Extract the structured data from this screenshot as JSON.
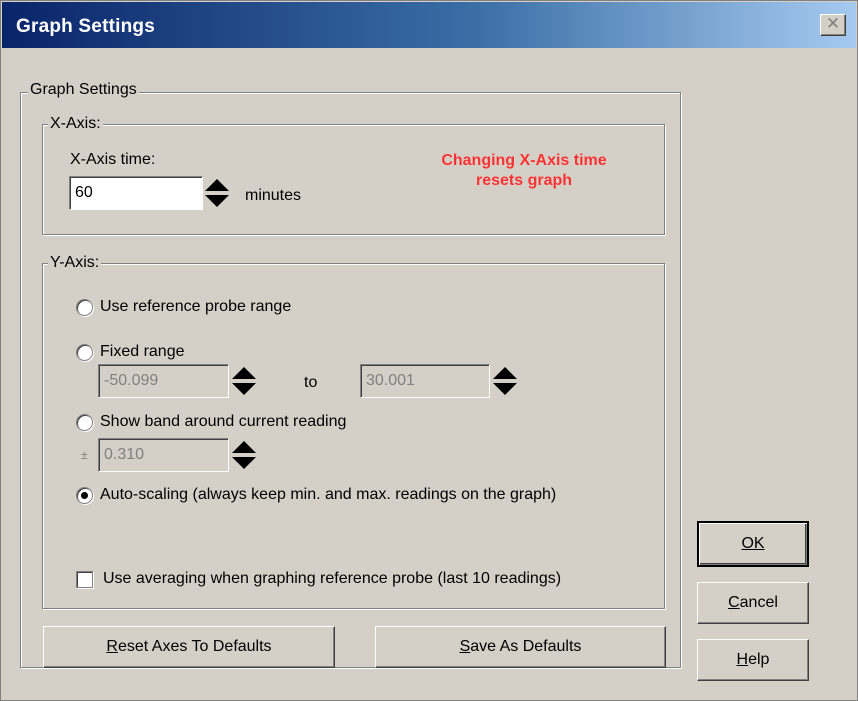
{
  "window": {
    "title": "Graph Settings",
    "close_glyph": "✕"
  },
  "group": {
    "label": "Graph Settings",
    "x_axis": {
      "label": "X-Axis:",
      "time_label": "X-Axis time:",
      "time_value": "60",
      "unit": "minutes",
      "warning_line1": "Changing X-Axis time",
      "warning_line2": "resets graph",
      "warning_color": "#ff3333"
    },
    "y_axis": {
      "label": "Y-Axis:",
      "option_reference": "Use reference probe range",
      "option_fixed": "Fixed range",
      "fixed_min": "-50.099",
      "to_label": "to",
      "fixed_max": "30.001",
      "option_band": "Show band around current reading",
      "band_symbol": "±",
      "band_value": "0.310",
      "option_auto": "Auto-scaling (always keep min. and max. readings on the graph)",
      "selected_option": "auto",
      "averaging_label": "Use averaging when graphing reference probe (last 10 readings)",
      "averaging_checked": false
    }
  },
  "buttons": {
    "reset_accel": "R",
    "reset_rest": "eset Axes To Defaults",
    "save_accel": "S",
    "save_rest": "ave As Defaults",
    "ok": "OK",
    "cancel_accel": "C",
    "cancel_rest": "ancel",
    "help_accel": "H",
    "help_rest": "elp"
  }
}
